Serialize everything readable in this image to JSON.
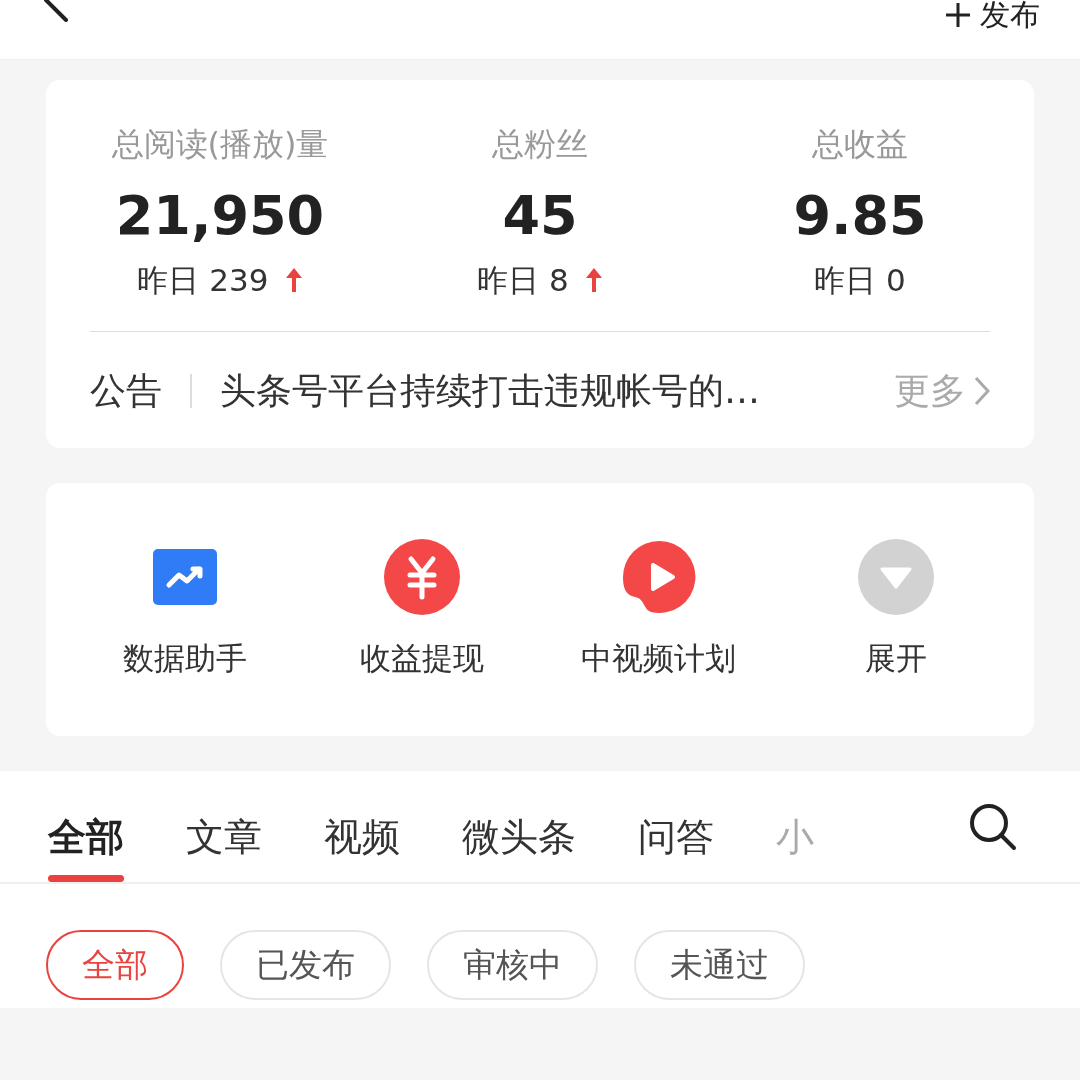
{
  "header": {
    "publish_label": "发布"
  },
  "stats": [
    {
      "label": "总阅读(播放)量",
      "value": "21,950",
      "yesterday": "昨日 239",
      "rising": true
    },
    {
      "label": "总粉丝",
      "value": "45",
      "yesterday": "昨日 8",
      "rising": true
    },
    {
      "label": "总收益",
      "value": "9.85",
      "yesterday": "昨日 0",
      "rising": false
    }
  ],
  "notice": {
    "label": "公告",
    "text": "头条号平台持续打击违规帐号的…",
    "more": "更多"
  },
  "tools": [
    {
      "label": "数据助手",
      "kind": "chart"
    },
    {
      "label": "收益提现",
      "kind": "yen"
    },
    {
      "label": "中视频计划",
      "kind": "play"
    },
    {
      "label": "展开",
      "kind": "expand"
    }
  ],
  "tabs": [
    {
      "label": "全部",
      "selected": true
    },
    {
      "label": "文章",
      "selected": false
    },
    {
      "label": "视频",
      "selected": false
    },
    {
      "label": "微头条",
      "selected": false
    },
    {
      "label": "问答",
      "selected": false
    },
    {
      "label": "小",
      "selected": false
    }
  ],
  "filters": [
    {
      "label": "全部",
      "selected": true
    },
    {
      "label": "已发布",
      "selected": false
    },
    {
      "label": "审核中",
      "selected": false
    },
    {
      "label": "未通过",
      "selected": false
    }
  ]
}
